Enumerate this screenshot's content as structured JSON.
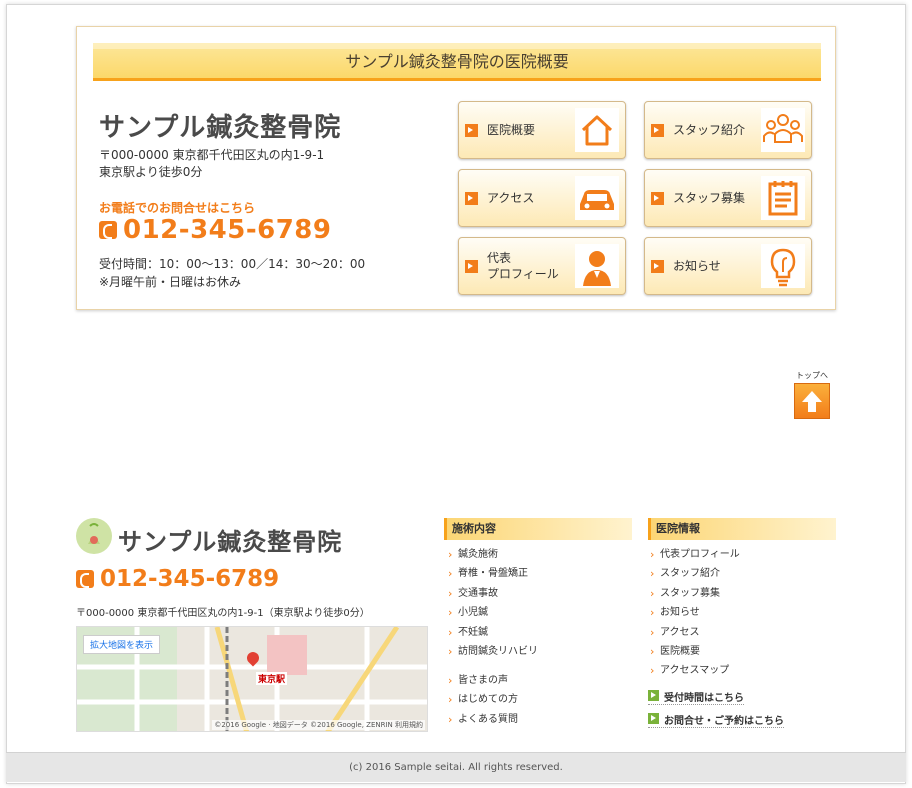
{
  "overview": {
    "section_title": "サンプル鍼灸整骨院の医院概要",
    "clinic_name": "サンプル鍼灸整骨院",
    "address_line1": "〒000-0000 東京都千代田区丸の内1-9-1",
    "address_line2": "東京駅より徒歩0分",
    "tel_caption": "お電話でのお問合せはこちら",
    "tel": "012-345-6789",
    "hours": "受付時間：10：00〜13：00／14：30〜20：00",
    "closed_note": "※月曜午前・日曜はお休み",
    "nav": [
      {
        "label": "医院概要",
        "icon": "house-icon"
      },
      {
        "label": "スタッフ紹介",
        "icon": "staff-group-icon"
      },
      {
        "label": "アクセス",
        "icon": "car-icon"
      },
      {
        "label": "スタッフ募集",
        "icon": "notepad-icon"
      },
      {
        "label_line1": "代表",
        "label_line2": "プロフィール",
        "icon": "person-icon"
      },
      {
        "label": "お知らせ",
        "icon": "lightbulb-icon"
      }
    ]
  },
  "to_top": {
    "label": "トップへ",
    "icon": "arrow-up-icon"
  },
  "footer": {
    "clinic_name": "サンプル鍼灸整骨院",
    "tel": "012-345-6789",
    "address": "〒000-0000 東京都千代田区丸の内1-9-1（東京駅より徒歩0分）",
    "map": {
      "enlarge_label": "拡大地図を表示",
      "station_label": "東京駅",
      "copyright": "©2016 Google · 地図データ ©2016 Google, ZENRIN   利用規約"
    },
    "treatment": {
      "heading": "施術内容",
      "items": [
        "鍼灸施術",
        "脊椎・骨盤矯正",
        "交通事故",
        "小児鍼",
        "不妊鍼",
        "訪問鍼灸リハビリ"
      ],
      "items2": [
        "皆さまの声",
        "はじめての方",
        "よくある質問"
      ]
    },
    "clinic_info": {
      "heading": "医院情報",
      "items": [
        "代表プロフィール",
        "スタッフ紹介",
        "スタッフ募集",
        "お知らせ",
        "アクセス",
        "医院概要",
        "アクセスマップ"
      ],
      "hours_link": "受付時間はこちら",
      "contact_link": "お問合せ・ご予約はこちら"
    },
    "copyright": "(c) 2016 Sample seitai. All rights reserved."
  },
  "colors": {
    "accent": "#f27d1a",
    "header_band": "#fbd86a",
    "link_green": "#7ab23a"
  }
}
